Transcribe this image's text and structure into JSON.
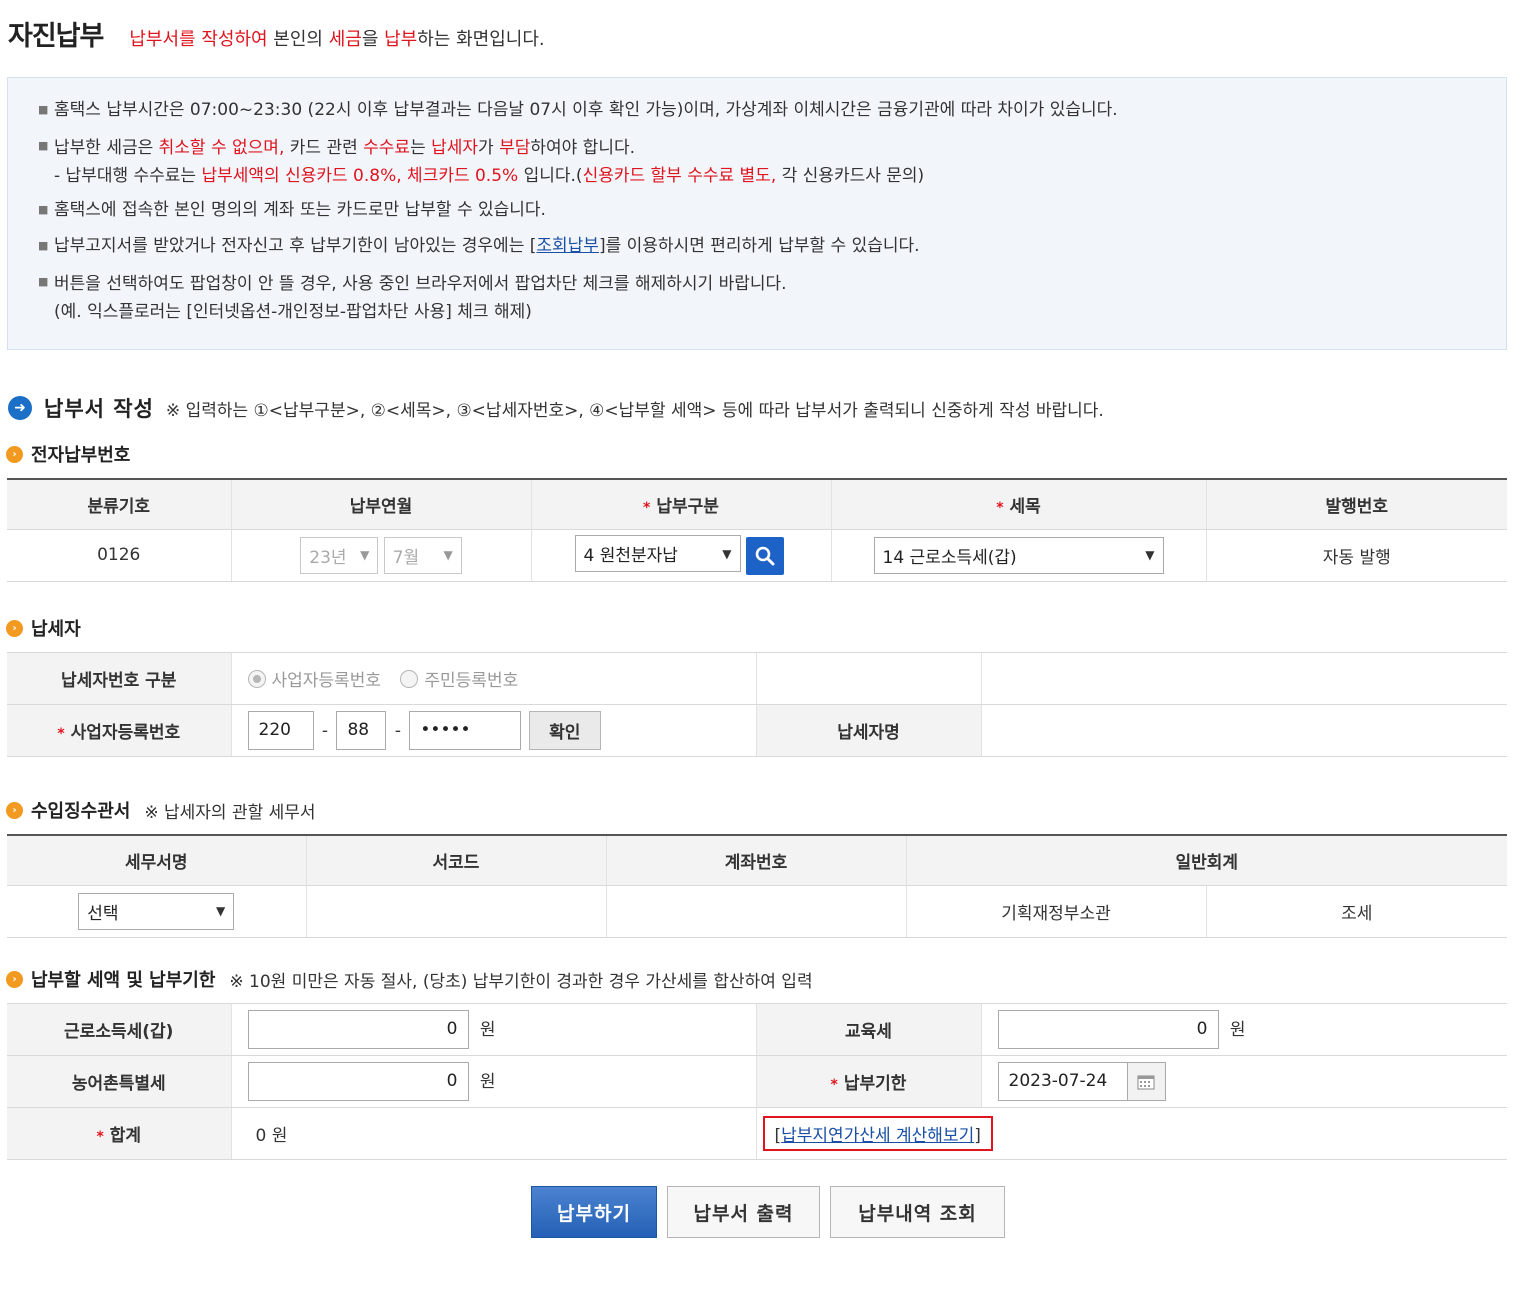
{
  "header": {
    "title": "자진납부",
    "desc_part1": "납부서를 작성하여",
    "desc_part2": " 본인의 ",
    "desc_part3": "세금",
    "desc_part4": "을 ",
    "desc_part5": "납부",
    "desc_part6": "하는 화면입니다."
  },
  "notice": {
    "line1": "홈택스 납부시간은 07:00~23:30 (22시 이후 납부결과는 다음날 07시 이후 확인 가능)이며, 가상계좌 이체시간은 금융기관에 따라 차이가 있습니다.",
    "line2_a": "납부한 세금은 ",
    "line2_b": "취소할 수 없으며,",
    "line2_c": " 카드 관련 ",
    "line2_d": "수수료",
    "line2_e": "는 ",
    "line2_f": "납세자",
    "line2_g": "가 ",
    "line2_h": "부담",
    "line2_i": "하여야 합니다.",
    "line2s_a": "- 납부대행 수수료는 ",
    "line2s_b": "납부세액의 신용카드 0.8%, 체크카드 0.5%",
    "line2s_c": " 입니다.(",
    "line2s_d": "신용카드 할부 수수료 별도,",
    "line2s_e": " 각 신용카드사 문의)",
    "line3": "홈택스에 접속한 본인 명의의 계좌 또는 카드로만 납부할 수 있습니다.",
    "line4_a": "납부고지서를 받았거나 전자신고 후 납부기한이 남아있는 경우에는 [",
    "line4_link": "조회납부",
    "line4_b": "]를 이용하시면 편리하게  납부할 수 있습니다.",
    "line5": "버튼을 선택하여도 팝업창이 안 뜰 경우, 사용 중인 브라우저에서 팝업차단 체크를 해제하시기 바랍니다.",
    "line5s": "(예. 익스플로러는 [인터넷옵션-개인정보-팝업차단 사용] 체크 해제)"
  },
  "main_section": {
    "title": "납부서 작성",
    "note": "※ 입력하는 ①<납부구분>, ②<세목>, ③<납세자번호>, ④<납부할 세액> 등에 따라 납부서가 출력되니 신중하게 작성 바랍니다."
  },
  "epay": {
    "heading": "전자납부번호",
    "headers": [
      "분류기호",
      "납부연월",
      "납부구분",
      "세목",
      "발행번호"
    ],
    "code": "0126",
    "year": "23년",
    "month": "7월",
    "pay_type": "4 원천분자납",
    "tax_item": "14 근로소득세(갑)",
    "issue_no": "자동 발행"
  },
  "taxpayer": {
    "heading": "납세자",
    "type_label": "납세자번호 구분",
    "radio1": "사업자등록번호",
    "radio2": "주민등록번호",
    "bizno_label": "사업자등록번호",
    "bizno1": "220",
    "bizno2": "88",
    "bizno3": "•••••",
    "dash": "-",
    "confirm": "확인",
    "name_label": "납세자명"
  },
  "office": {
    "heading": "수입징수관서",
    "note": "※ 납세자의 관할 세무서",
    "headers": [
      "세무서명",
      "서코드",
      "계좌번호",
      "일반회계"
    ],
    "select": "선택",
    "ministry": "기획재정부소관",
    "tax": "조세"
  },
  "amount": {
    "heading": "납부할 세액 및 납부기한",
    "note": "※ 10원 미만은 자동 절사, (당초) 납부기한이 경과한 경우 가산세를 합산하여 입력",
    "income_tax_label": "근로소득세(갑)",
    "income_tax": "0",
    "edu_tax_label": "교육세",
    "edu_tax": "0",
    "farm_tax_label": "농어촌특별세",
    "farm_tax": "0",
    "deadline_label": "납부기한",
    "deadline": "2023-07-24",
    "total_label": "합계",
    "total": "0 원",
    "won": "원",
    "late_link_open": "[",
    "late_link": "납부지연가산세 계산해보기",
    "late_link_close": "]"
  },
  "buttons": {
    "pay": "납부하기",
    "print": "납부서 출력",
    "history": "납부내역 조회"
  },
  "colors": {
    "accent": "#1d62c6",
    "red": "#e0141e",
    "orange": "#f29a1f"
  }
}
